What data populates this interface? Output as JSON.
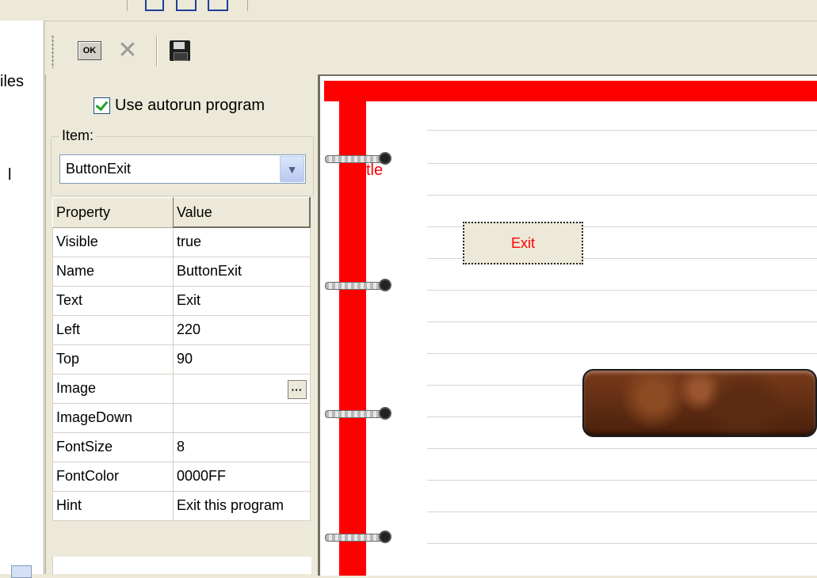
{
  "left_panel": {
    "files_label": "iles",
    "cut_text": "l"
  },
  "toolbar": {
    "ok_label": "OK"
  },
  "props": {
    "autorun_label": "Use autorun program",
    "autorun_checked": true,
    "item_legend": "Item:",
    "item_value": "ButtonExit",
    "grid_headers": {
      "property": "Property",
      "value": "Value"
    },
    "rows": [
      {
        "property": "Visible",
        "value": "true"
      },
      {
        "property": "Name",
        "value": "ButtonExit"
      },
      {
        "property": "Text",
        "value": "Exit"
      },
      {
        "property": "Left",
        "value": "220"
      },
      {
        "property": "Top",
        "value": "90"
      },
      {
        "property": "Image",
        "value": ""
      },
      {
        "property": "ImageDown",
        "value": ""
      },
      {
        "property": "FontSize",
        "value": "8"
      },
      {
        "property": "FontColor",
        "value": "0000FF"
      },
      {
        "property": "Hint",
        "value": "Exit this program"
      }
    ]
  },
  "canvas": {
    "cut_title": "tle",
    "exit_button_label": "Exit",
    "colors": {
      "frame": "#ff0000",
      "exit_text": "#ff0000"
    }
  }
}
